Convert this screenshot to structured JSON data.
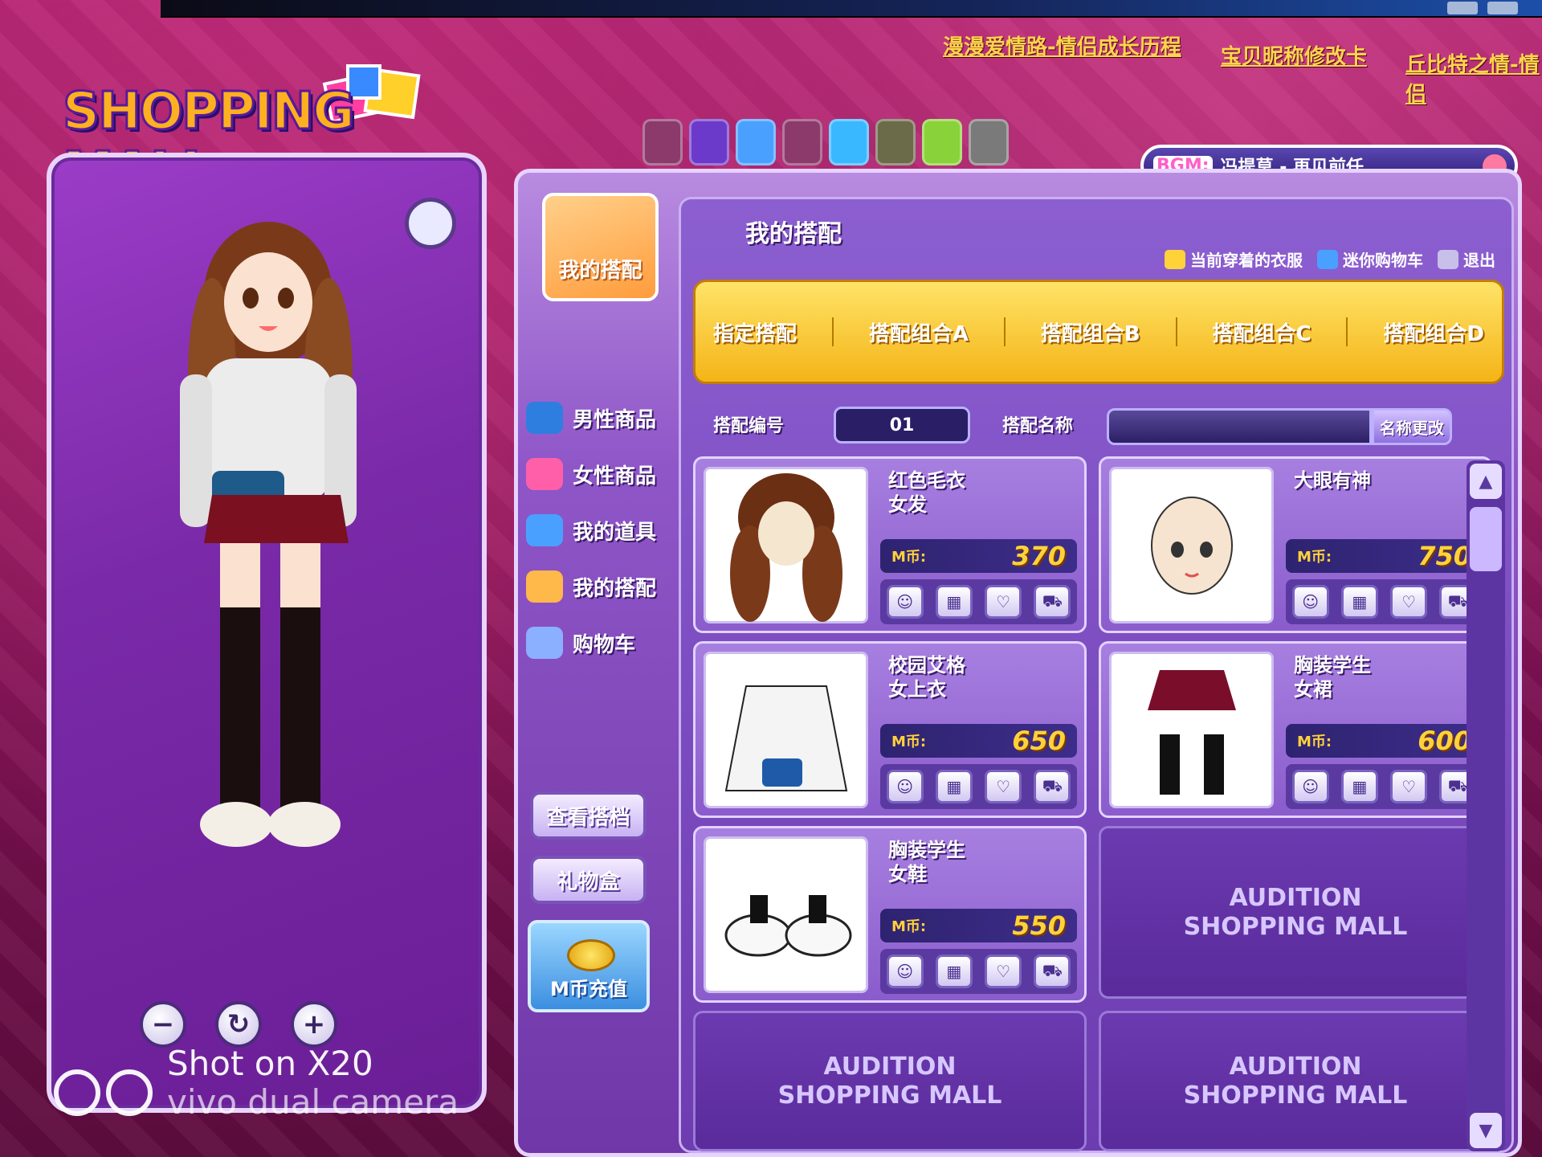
{
  "top_links": [
    "漫漫爱情路-情侣成长历程",
    "宝贝昵称修改卡",
    "丘比特之情-情侣"
  ],
  "logo": {
    "text": "SHOPPING MALL"
  },
  "bgm": {
    "tag": "BGM:",
    "song": "冯提莫 - 再见前任"
  },
  "top_icons": [
    "blank-icon",
    "shell-icon",
    "monster-icon",
    "blank-icon",
    "tv-icon",
    "photo-icon",
    "garden-icon",
    "phone-icon"
  ],
  "side_logo": "我的搭配",
  "nav": [
    {
      "label": "男性商品",
      "icon": "male-icon",
      "color": "#2e7ee0"
    },
    {
      "label": "女性商品",
      "icon": "female-icon",
      "color": "#ff5fa8"
    },
    {
      "label": "我的道具",
      "icon": "box-icon",
      "color": "#4aa0ff"
    },
    {
      "label": "我的搭配",
      "icon": "clothes-icon",
      "color": "#ffb84a"
    },
    {
      "label": "购物车",
      "icon": "cart-icon",
      "color": "#8ab0ff"
    }
  ],
  "side_buttons": {
    "view_file": "查看搭档",
    "gift_box": "礼物盒",
    "recharge": "M币充值"
  },
  "content": {
    "title": "我的搭配",
    "toolbar": {
      "current": "当前穿着的衣服",
      "mini_cart": "迷你购物车",
      "exit": "退出"
    },
    "tabs": [
      "指定搭配",
      "搭配组合A",
      "搭配组合B",
      "搭配组合C",
      "搭配组合D"
    ],
    "id_label": "搭配编号",
    "id_value": "01",
    "name_label": "搭配名称",
    "rename": "名称更改"
  },
  "currency_label": "M币:",
  "items": [
    {
      "name": "红色毛衣\n女发",
      "price": "370"
    },
    {
      "name": "大眼有神",
      "price": "750"
    },
    {
      "name": "校园艾格\n女上衣",
      "price": "650"
    },
    {
      "name": "胸装学生\n女裙",
      "price": "600"
    },
    {
      "name": "胸装学生\n女鞋",
      "price": "550"
    }
  ],
  "empty_slot": "AUDITION\nSHOPPING MALL",
  "watermark": {
    "line1": "Shot on X20",
    "line2": "vivo dual camera"
  },
  "colors": {
    "accent": "#ffd23a",
    "panel": "#8c5fd1",
    "tab_bar": "#f4b417"
  }
}
